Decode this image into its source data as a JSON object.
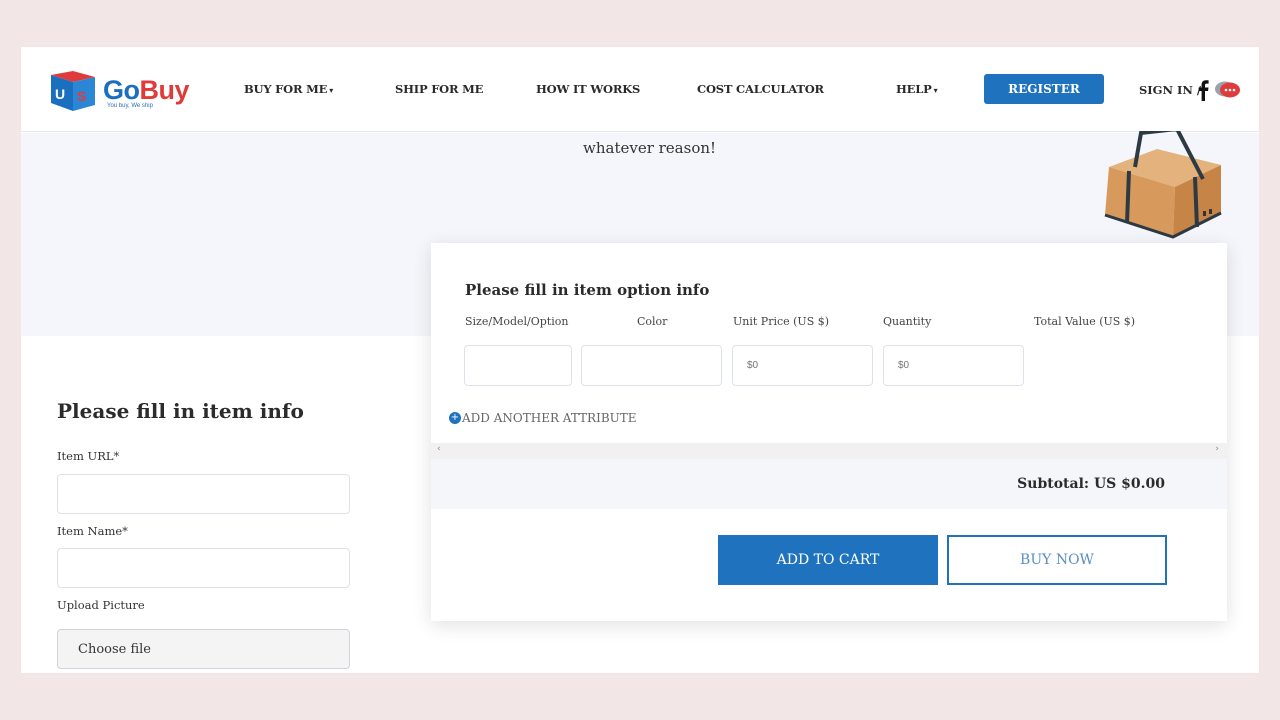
{
  "header": {
    "logo": {
      "go": "Go",
      "buy": "Buy",
      "tagline": "You buy, We ship"
    },
    "nav": [
      {
        "label": "BUY FOR ME",
        "has_dropdown": true
      },
      {
        "label": "SHIP FOR ME",
        "has_dropdown": false
      },
      {
        "label": "HOW IT WORKS",
        "has_dropdown": false
      },
      {
        "label": "COST CALCULATOR",
        "has_dropdown": false
      },
      {
        "label": "HELP",
        "has_dropdown": true
      }
    ],
    "register_label": "REGISTER",
    "signin_label": "SIGN IN /",
    "icons": [
      "facebook-icon",
      "chat-icon"
    ]
  },
  "hero": {
    "text": "whatever reason!"
  },
  "item_info": {
    "title": "Please fill in item info",
    "url_label": "Item URL*",
    "url_value": "",
    "name_label": "Item Name*",
    "name_value": "",
    "upload_label": "Upload Picture",
    "file_button": "Choose file"
  },
  "option_panel": {
    "title": "Please fill in item option info",
    "columns": [
      "Size/Model/Option",
      "Color",
      "Unit Price (US $)",
      "Quantity",
      "Total Value (US $)"
    ],
    "inputs": {
      "size": {
        "value": "",
        "placeholder": ""
      },
      "color": {
        "value": "",
        "placeholder": ""
      },
      "unit_price": {
        "value": "",
        "placeholder": "$0"
      },
      "quantity": {
        "value": "",
        "placeholder": "$0"
      }
    },
    "add_attribute": "ADD ANOTHER ATTRIBUTE",
    "subtotal": "Subtotal: US $0.00",
    "add_to_cart": "ADD TO CART",
    "buy_now": "BUY NOW"
  },
  "colors": {
    "brand_blue": "#1f73be",
    "brand_red": "#e03b3b",
    "page_bg": "#f2e6e6",
    "hero_bg": "#f4f6fb"
  }
}
